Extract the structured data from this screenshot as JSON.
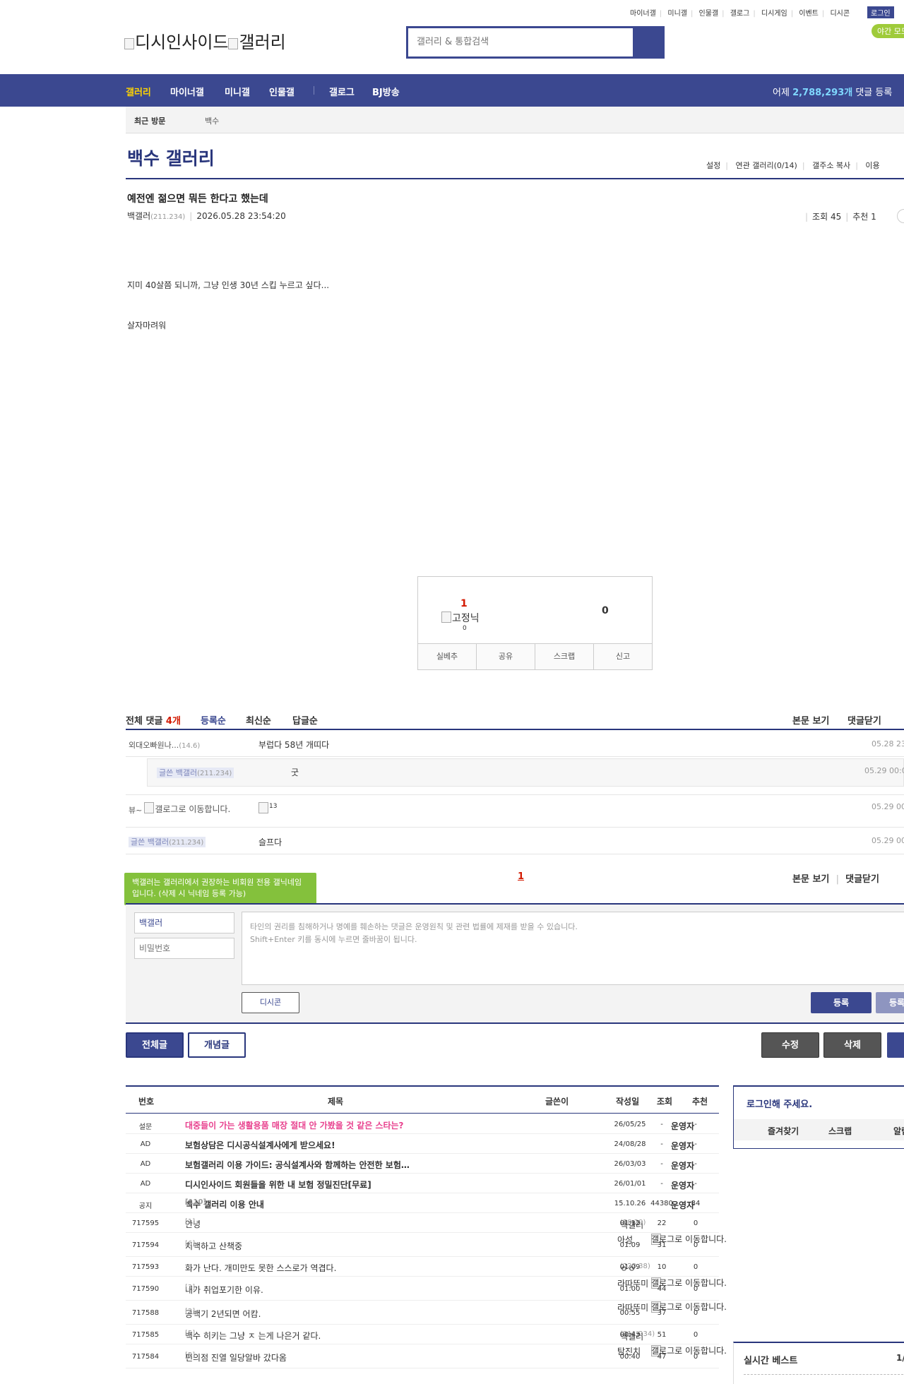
{
  "util_links": [
    "마이너갤",
    "미니갤",
    "인물갤",
    "갤로그",
    "디시게임",
    "이벤트",
    "디시콘"
  ],
  "login_label": "로그인",
  "night_mode": "야간 모드",
  "logo_alt_1": "디시인사이드",
  "logo_alt_2": "갤러리",
  "search_placeholder": "갤러리 & 통합검색",
  "gnb": {
    "items": [
      "갤러리",
      "마이너갤",
      "미니갤",
      "인물갤",
      "갤로그",
      "BJ방송"
    ],
    "stat_prefix": "어제 ",
    "stat_value": "2,788,293개",
    "stat_suffix": " 댓글 등록"
  },
  "visit": {
    "label": "최근 방문",
    "item": "백수"
  },
  "gallery": {
    "title": "백수 갤러리",
    "menu": [
      "설정",
      "연관 갤러리(0/14)",
      "갤주소 복사",
      "이용"
    ]
  },
  "post": {
    "title": "예전엔 젊으면 뭐든 한다고 했는데",
    "writer": "백갤러",
    "writer_ip": "(211.234)",
    "date": "2026.05.28 23:54:20",
    "views": "조회 45",
    "recommends": "추천 1",
    "body": [
      "지미 40살쯤 되니까, 그냥 인생 30년 스킵 누르고 싶다...",
      "살자마려워"
    ]
  },
  "recommend": {
    "up": "1",
    "img_alt": "고정닉",
    "fixed": "0",
    "down": "0",
    "buttons": [
      "실베추",
      "공유",
      "스크랩",
      "신고"
    ]
  },
  "comments": {
    "total_label": "전체 댓글 ",
    "total_count": "4개",
    "sorts": [
      "등록순",
      "최신순",
      "답글순"
    ],
    "right": [
      "본문 보기",
      "댓글닫기"
    ],
    "rows": [
      {
        "nick": "외대오빠원나...",
        "ip": "(14.6)",
        "text": "부럽다 58년 개띠다",
        "date": "05.28 23:"
      },
      {
        "writer_label": "글쓴 백갤러",
        "ip": "(211.234)",
        "text": "굿",
        "date": "05.29 00:0"
      },
      {
        "nick": "뷰~",
        "img_alt": "갤로그로 이동합니다.",
        "text_img_alt": "13",
        "date": "05.29 00"
      },
      {
        "writer_label": "글쓴 백갤러",
        "ip": "(211.234)",
        "text": "슬프다",
        "date": "05.29 00"
      }
    ],
    "page": "1"
  },
  "write": {
    "tooltip": "백갤러는 갤러리에서 권장하는 비회원 전용 갤닉네임입니다. (삭제 시 닉네임 등록 가능)",
    "nick": "백갤러",
    "password_placeholder": "비밀번호",
    "notice_1": "타인의 권리를 침해하거나 명예를 훼손하는 댓글은 운영원칙 및 관련 법률에 제재를 받을 수 있습니다.",
    "notice_2": "Shift+Enter 키를 동시에 누르면 줄바꿈이 됩니다.",
    "dccon": "디시콘",
    "register": "등록",
    "register2": "등록"
  },
  "post_buttons": {
    "all": "전체글",
    "concept": "개념글",
    "edit": "수정",
    "delete": "삭제"
  },
  "list": {
    "headers": [
      "번호",
      "제목",
      "글쓴이",
      "작성일",
      "조회",
      "추천"
    ],
    "rows": [
      {
        "no": "설문",
        "title": "대중들이 가는 생활용품 매장 절대 안 가봤을 것 같은 스타는?",
        "rc": "",
        "writer": "운영자",
        "date": "26/05/25",
        "views": "-",
        "rec": "-"
      },
      {
        "no": "AD",
        "title": "보험상담은 디시공식설계사에게 받으세요!",
        "rc": "",
        "writer": "운영자",
        "date": "24/08/28",
        "views": "-",
        "rec": "-"
      },
      {
        "no": "AD",
        "title": "보험갤러리 이용 가이드: 공식설계사와 함께하는 안전한 보험…",
        "rc": "",
        "writer": "운영자",
        "date": "26/03/03",
        "views": "-",
        "rec": "-"
      },
      {
        "no": "AD",
        "title": "디시인사이드 회원들을 위한 내 보험 정밀진단[무료]",
        "rc": "",
        "writer": "운영자",
        "date": "26/01/01",
        "views": "-",
        "rec": "-"
      },
      {
        "no": "공지",
        "title": "백수 갤러리 이용 안내",
        "rc": "[110]",
        "writer": "운영자",
        "date": "15.10.26",
        "views": "44380",
        "rec": "84"
      },
      {
        "no": "717595",
        "title": "안녕",
        "rc": "[1]",
        "writer": "백갤러",
        "ip": "(58.29)",
        "date": "01:12",
        "views": "22",
        "rec": "0"
      },
      {
        "no": "717594",
        "title": "치맥하고 산책중",
        "rc": "[6]",
        "writer": "아성",
        "img": "갤로그로 이동합니다.",
        "date": "01:09",
        "views": "31",
        "rec": "0"
      },
      {
        "no": "717593",
        "title": "화가 난다. 개미만도 못한 스스로가 역겹다.",
        "rc": "",
        "writer": "ㅇㅇ",
        "ip": "(223.38)",
        "date": "01:09",
        "views": "10",
        "rec": "0"
      },
      {
        "no": "717590",
        "title": "내가 취업포기한 이유.",
        "rc": "[3]",
        "writer": "라따뚜미",
        "img": "갤로그로 이동합니다.",
        "date": "01:00",
        "views": "44",
        "rec": "0"
      },
      {
        "no": "717588",
        "title": "공백기 2년되면 어캄.",
        "rc": "[2]",
        "writer": "라따뚜미",
        "img": "갤로그로 이동합니다.",
        "date": "00:55",
        "views": "37",
        "rec": "0"
      },
      {
        "no": "717585",
        "title": "백수 히키는 그냥 ㅈ 는게 나은거 같다.",
        "rc": "[5]",
        "writer": "백갤러",
        "ip": "(211.234)",
        "date": "00:43",
        "views": "51",
        "rec": "0"
      },
      {
        "no": "717584",
        "title": "편의점 진열 일당알바 갔다옴",
        "rc": "[5]",
        "writer": "탐진치",
        "img": "갤로그로 이동합니다.",
        "date": "00:40",
        "views": "47",
        "rec": "0"
      }
    ]
  },
  "side": {
    "login_title": "로그인해 주세요.",
    "tabs": [
      "즐겨찾기",
      "스크랩",
      "알림"
    ],
    "best_title": "실시간 베스트",
    "best_page": "1/"
  },
  "colors": {
    "brand": "#3b4890",
    "brand_dark": "#29367c",
    "accent_red": "#d31900",
    "survey_pink": "#e8418e",
    "night_green": "#9fcb3a"
  }
}
